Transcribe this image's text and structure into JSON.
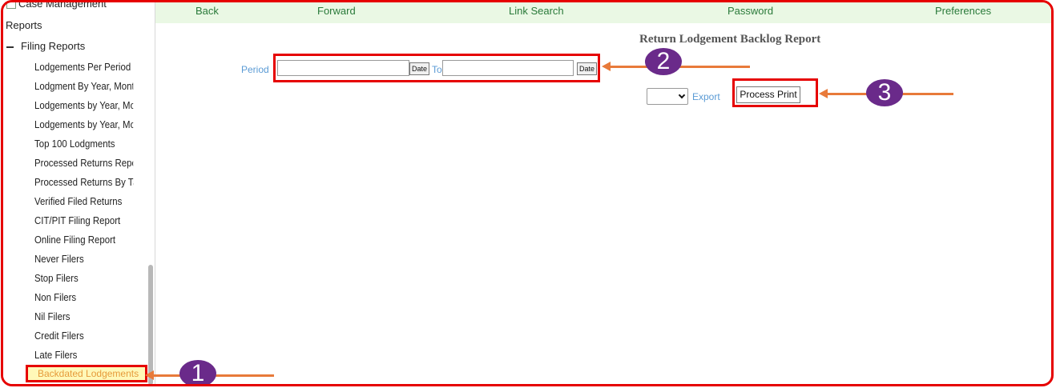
{
  "sidebar": {
    "top_item": "Case Management",
    "section": "Reports",
    "group": "Filing Reports",
    "items": [
      "Lodgements Per Period",
      "Lodgment By Year, Month a",
      "Lodgements by Year, Montl",
      "Lodgements by Year, Montl",
      "Top 100 Lodgments",
      "Processed Returns Report",
      "Processed Returns By Tax",
      "Verified Filed Returns",
      "CIT/PIT Filing Report",
      "Online Filing Report",
      "Never Filers",
      "Stop Filers",
      "Non Filers",
      "Nil Filers",
      "Credit Filers",
      "Late Filers",
      "Backdated Lodgements"
    ]
  },
  "nav": {
    "back": "Back",
    "forward": "Forward",
    "link_search": "Link Search",
    "password": "Password",
    "preferences": "Preferences"
  },
  "report": {
    "title": "Return Lodgement Backlog Report",
    "period_label": "Period",
    "to_label": "To",
    "date_button": "Date",
    "from_value": "",
    "to_value": "",
    "export_selected": "",
    "export_label": "Export",
    "process_button": "Process Print"
  },
  "annotations": {
    "badge_1": "1",
    "badge_2": "2",
    "badge_3": "3",
    "highlight_color": "#e60000",
    "arrow_color": "#e87a3a",
    "badge_color": "#6a2a8a"
  }
}
